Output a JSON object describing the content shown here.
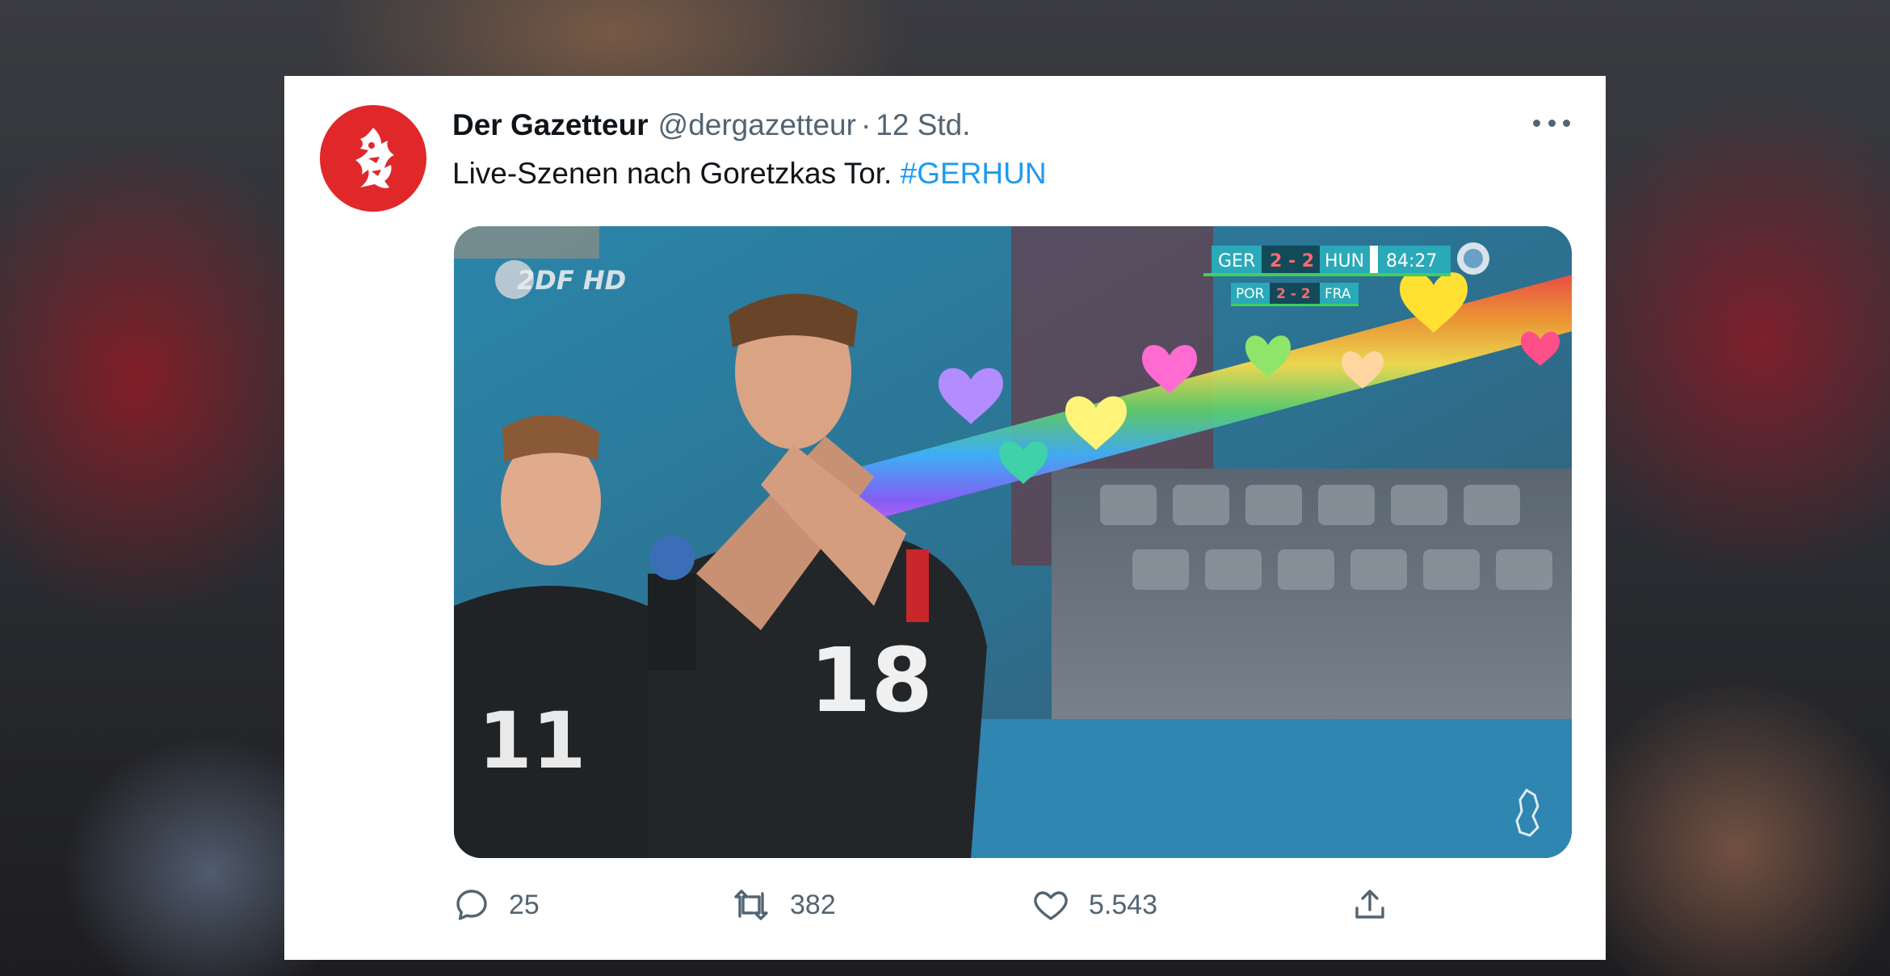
{
  "tweet": {
    "display_name": "Der Gazetteur",
    "handle": "@dergazetteur",
    "separator": "·",
    "time": "12 Std.",
    "text": "Live-Szenen nach Goretzkas Tor.",
    "hashtag": "#GERHUN"
  },
  "media": {
    "broadcaster_logo": "2DF HD",
    "scoreboard": {
      "home": "GER",
      "score": "2 - 2",
      "away": "HUN",
      "clock": "84:27",
      "other_home": "POR",
      "other_score": "2 - 2",
      "other_away": "FRA"
    },
    "jersey_front": "18",
    "jersey_back": "11"
  },
  "actions": {
    "reply_count": "25",
    "retweet_count": "382",
    "like_count": "5.543"
  },
  "colors": {
    "accent": "#1d9bf0",
    "avatar_bg": "#e0282a",
    "muted_text": "#536471"
  },
  "icons": {
    "avatar": "dragon-logo-icon",
    "more": "more-horizontal-icon",
    "reply": "reply-icon",
    "retweet": "retweet-icon",
    "like": "heart-icon",
    "share": "share-icon"
  }
}
